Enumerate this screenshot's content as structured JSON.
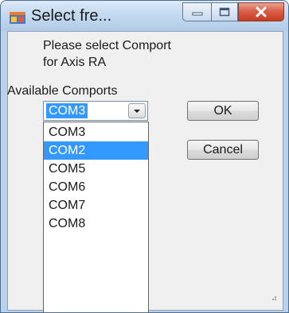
{
  "window": {
    "title": "Select fre..."
  },
  "dialog": {
    "prompt": "Please select Comport\nfor Axis RA",
    "available_label": "Available Comports",
    "selected_value": "COM3",
    "options": [
      "COM3",
      "COM2",
      "COM5",
      "COM6",
      "COM7",
      "COM8"
    ],
    "highlighted_option": "COM2",
    "ok_label": "OK",
    "cancel_label": "Cancel"
  },
  "icons": {
    "app": "app-window-icon",
    "minimize": "minimize-icon",
    "maximize": "maximize-icon",
    "close": "close-icon",
    "dropdown": "chevron-down-icon"
  },
  "colors": {
    "selection": "#3399ff",
    "close_button": "#c53a22",
    "titlebar": "#c4daf0"
  }
}
